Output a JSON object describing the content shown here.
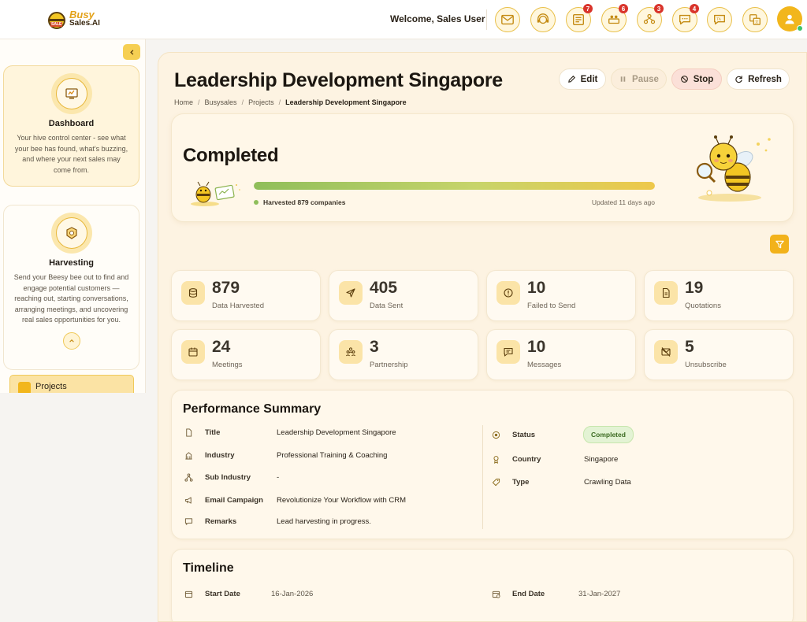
{
  "header": {
    "logo_line1": "Busy",
    "logo_line2": "Sales.AI",
    "logo_tag": "SALE",
    "welcome": "Welcome, Sales User",
    "icons": [
      {
        "name": "mail-icon",
        "badge": ""
      },
      {
        "name": "support-icon",
        "badge": ""
      },
      {
        "name": "board-icon",
        "badge": "7"
      },
      {
        "name": "meeting-icon",
        "badge": "6"
      },
      {
        "name": "team-icon",
        "badge": "3"
      },
      {
        "name": "chat-icon",
        "badge": "4"
      },
      {
        "name": "translate-chat-icon",
        "badge": ""
      },
      {
        "name": "language-icon",
        "badge": ""
      }
    ],
    "status_color": "#3cc36a"
  },
  "sidebar": {
    "dashboard": {
      "title": "Dashboard",
      "desc": "Your hive control center - see what your bee has found, what's buzzing, and where your next sales may come from."
    },
    "harvesting": {
      "title": "Harvesting",
      "desc": "Send your Beesy bee out to find and engage potential customers — reaching out, starting conversations, arranging meetings, and uncovering real sales opportunities for you."
    },
    "nav_projects": "Projects"
  },
  "page": {
    "title": "Leadership Development Singapore",
    "breadcrumb": [
      "Home",
      "Busysales",
      "Projects",
      "Leadership Development Singapore"
    ],
    "buttons": {
      "edit": "Edit",
      "pause": "Pause",
      "stop": "Stop",
      "refresh": "Refresh"
    }
  },
  "hero": {
    "status": "Completed",
    "progress_percent": 100,
    "harvested": "Harvested 879 companies",
    "updated": "Updated 11 days ago"
  },
  "stats": [
    {
      "value": "879",
      "label": "Data Harvested",
      "icon": "database-icon"
    },
    {
      "value": "405",
      "label": "Data Sent",
      "icon": "send-icon"
    },
    {
      "value": "10",
      "label": "Failed to Send",
      "icon": "alert-icon"
    },
    {
      "value": "19",
      "label": "Quotations",
      "icon": "document-icon"
    },
    {
      "value": "24",
      "label": "Meetings",
      "icon": "calendar-icon"
    },
    {
      "value": "3",
      "label": "Partnership",
      "icon": "people-icon"
    },
    {
      "value": "10",
      "label": "Messages",
      "icon": "message-icon"
    },
    {
      "value": "5",
      "label": "Unsubscribe",
      "icon": "unsubscribe-icon"
    }
  ],
  "performance": {
    "title": "Performance Summary",
    "left": [
      {
        "key": "Title",
        "value": "Leadership Development Singapore",
        "icon": "file-icon"
      },
      {
        "key": "Industry",
        "value": "Professional Training & Coaching",
        "icon": "building-icon"
      },
      {
        "key": "Sub Industry",
        "value": "-",
        "icon": "sitemap-icon"
      },
      {
        "key": "Email Campaign",
        "value": "Revolutionize Your Workflow with CRM",
        "icon": "megaphone-icon"
      },
      {
        "key": "Remarks",
        "value": "Lead harvesting in progress.",
        "icon": "comment-icon"
      }
    ],
    "right": [
      {
        "key": "Status",
        "value": "Completed",
        "icon": "status-icon"
      },
      {
        "key": "Country",
        "value": "Singapore",
        "icon": "pin-icon"
      },
      {
        "key": "Type",
        "value": "Crawling Data",
        "icon": "tag-icon"
      }
    ]
  },
  "timeline": {
    "title": "Timeline",
    "start_label": "Start Date",
    "start_value": "16-Jan-2026",
    "end_label": "End Date",
    "end_value": "31-Jan-2027"
  }
}
